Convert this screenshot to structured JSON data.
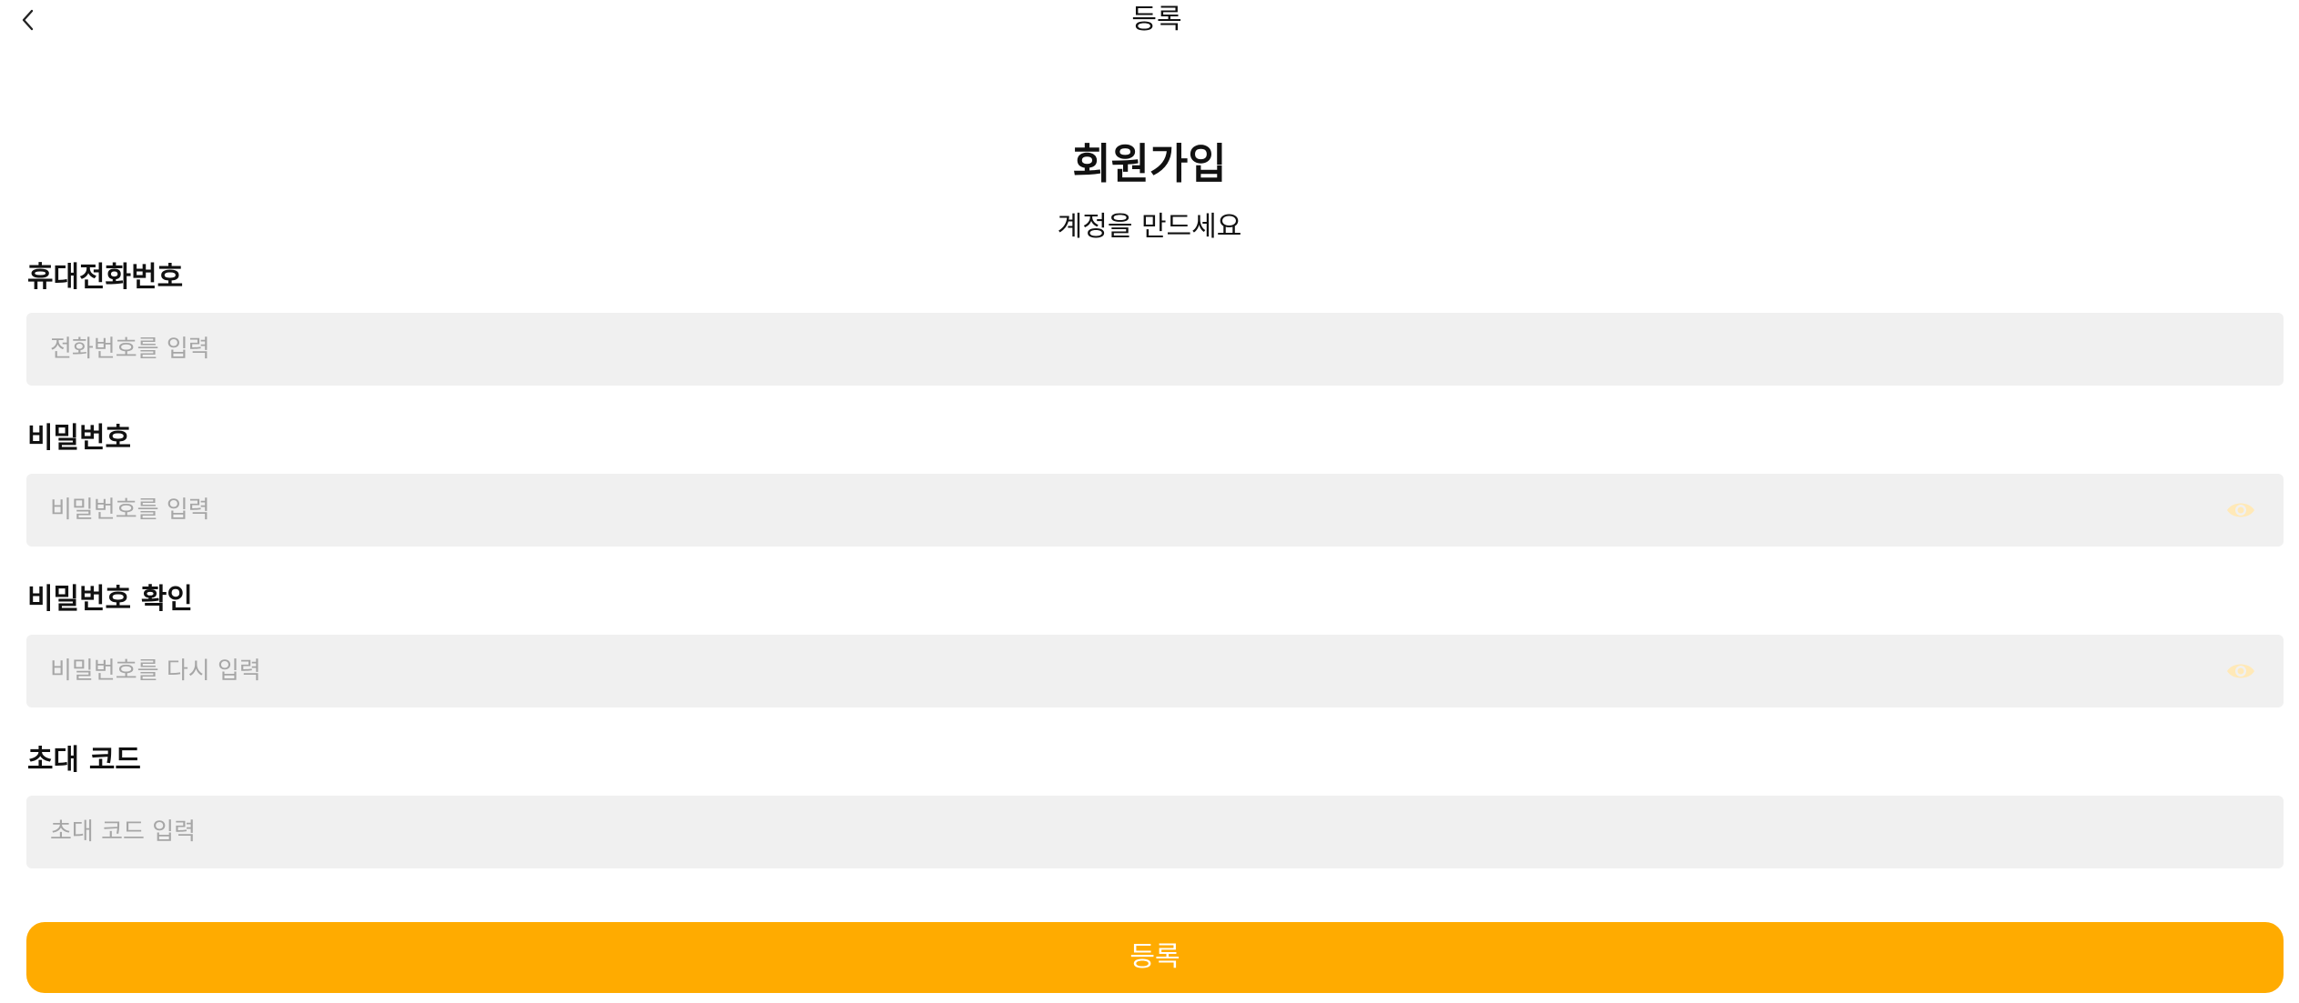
{
  "nav": {
    "back_icon": "chevron-left-icon",
    "title": "등록"
  },
  "header": {
    "title": "회원가입",
    "subtitle": "계정을 만드세요"
  },
  "form": {
    "phone": {
      "label": "휴대전화번호",
      "placeholder": "전화번호를 입력",
      "value": ""
    },
    "password": {
      "label": "비밀번호",
      "placeholder": "비밀번호를 입력",
      "value": "",
      "toggle_icon": "eye-icon"
    },
    "password_confirm": {
      "label": "비밀번호 확인",
      "placeholder": "비밀번호를 다시 입력",
      "value": "",
      "toggle_icon": "eye-icon"
    },
    "invite_code": {
      "label": "초대 코드",
      "placeholder": "초대 코드 입력",
      "value": ""
    },
    "submit_label": "등록"
  },
  "colors": {
    "accent": "#ffab00",
    "field_background": "#f0f0f0",
    "placeholder": "#a6a6a6",
    "eye_icon": "#ffe9b8"
  }
}
